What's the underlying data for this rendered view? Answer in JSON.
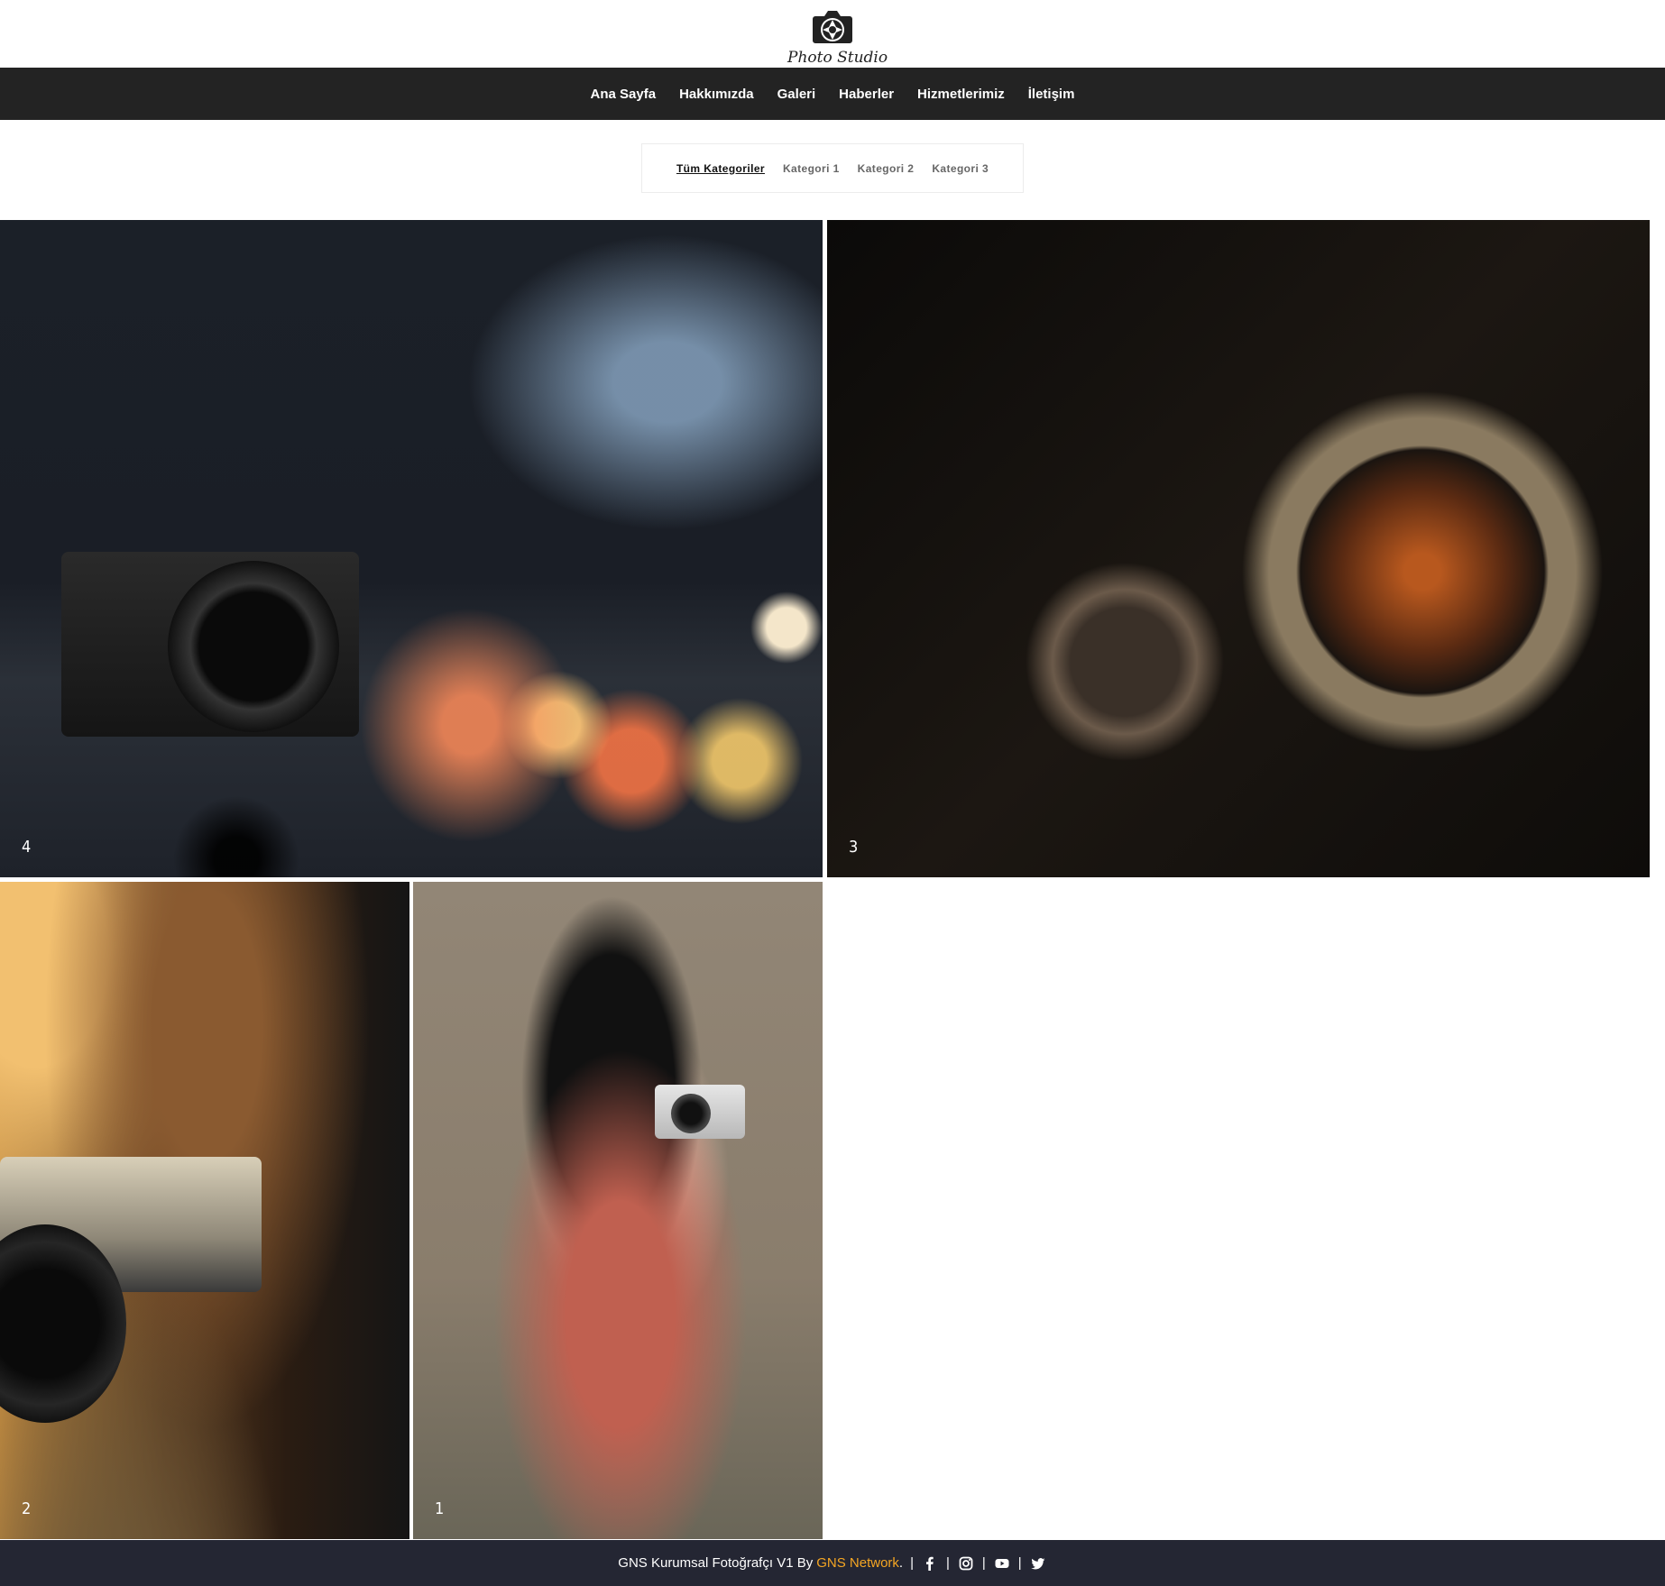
{
  "header": {
    "logo_text": "Photo Studio"
  },
  "nav": {
    "items": [
      {
        "label": "Ana Sayfa"
      },
      {
        "label": "Hakkımızda"
      },
      {
        "label": "Galeri"
      },
      {
        "label": "Haberler"
      },
      {
        "label": "Hizmetlerimiz"
      },
      {
        "label": "İletişim"
      }
    ]
  },
  "filters": {
    "items": [
      {
        "label": "Tüm Kategoriler",
        "active": true
      },
      {
        "label": "Kategori 1",
        "active": false
      },
      {
        "label": "Kategori 2",
        "active": false
      },
      {
        "label": "Kategori 3",
        "active": false
      }
    ]
  },
  "gallery": {
    "items": [
      {
        "caption": "4"
      },
      {
        "caption": "3"
      },
      {
        "caption": "2"
      },
      {
        "caption": "1"
      }
    ]
  },
  "footer": {
    "text": "GNS Kurumsal Fotoğrafçı V1 By",
    "brand": "GNS Network",
    "brand_suffix": ".",
    "divider": "|",
    "social_icons": [
      "facebook-icon",
      "instagram-icon",
      "youtube-icon",
      "twitter-icon"
    ],
    "brand_color": "#f5a623"
  },
  "colors": {
    "navbar_bg": "#232323",
    "footer_bg": "#242633"
  }
}
